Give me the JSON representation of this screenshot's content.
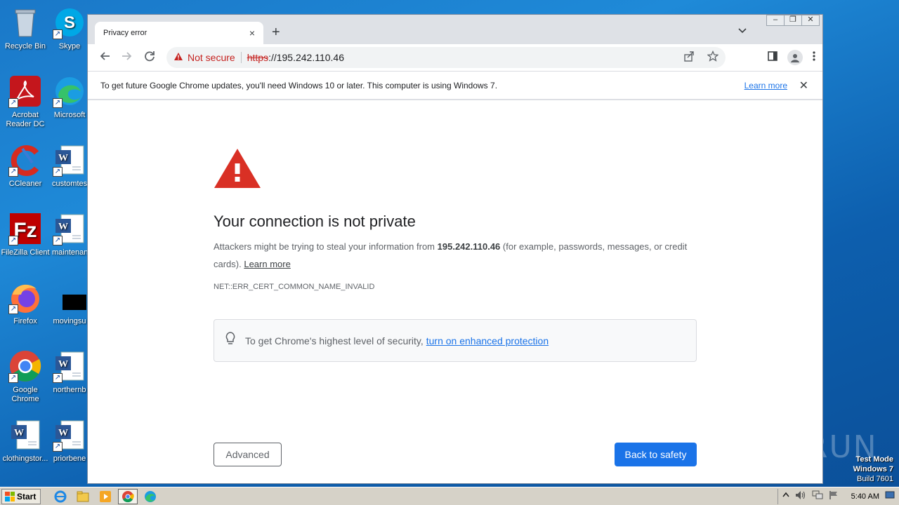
{
  "desktop": {
    "icons": [
      {
        "label": "Recycle Bin"
      },
      {
        "label": "Skype"
      },
      {
        "label": "Acrobat Reader DC"
      },
      {
        "label": "Microsoft"
      },
      {
        "label": "CCleaner"
      },
      {
        "label": "customtes"
      },
      {
        "label": "FileZilla Client"
      },
      {
        "label": "maintenan"
      },
      {
        "label": "Firefox"
      },
      {
        "label": "movingsu"
      },
      {
        "label": "Google Chrome"
      },
      {
        "label": "northernb"
      },
      {
        "label": "clothingstor..."
      },
      {
        "label": "priorbene"
      }
    ],
    "watermark": {
      "line1": "Test Mode",
      "line2": "Windows 7",
      "line3": "Build 7601"
    },
    "anyrun": "ANY RUN"
  },
  "taskbar": {
    "start_label": "Start",
    "clock": "5:40 AM"
  },
  "browser": {
    "tab_title": "Privacy error",
    "tab_close": "×",
    "new_tab": "+",
    "not_secure": "Not secure",
    "url_scheme": "https",
    "url_rest": "://195.242.110.46",
    "infobar": {
      "text": "To get future Google Chrome updates, you'll need Windows 10 or later. This computer is using Windows 7.",
      "learn_more": "Learn more",
      "close": "✕"
    }
  },
  "page": {
    "heading": "Your connection is not private",
    "desc_before": "Attackers might be trying to steal your information from ",
    "desc_host": "195.242.110.46",
    "desc_after": " (for example, passwords, messages, or credit cards). ",
    "desc_link": "Learn more",
    "error_code": "NET::ERR_CERT_COMMON_NAME_INVALID",
    "enhanced_text": "To get Chrome's highest level of security,",
    "enhanced_link": "turn on enhanced protection",
    "advanced_label": "Advanced",
    "back_label": "Back to safety"
  },
  "colors": {
    "accent": "#1a73e8",
    "danger": "#c5221f",
    "warning_triangle": "#d93025"
  }
}
